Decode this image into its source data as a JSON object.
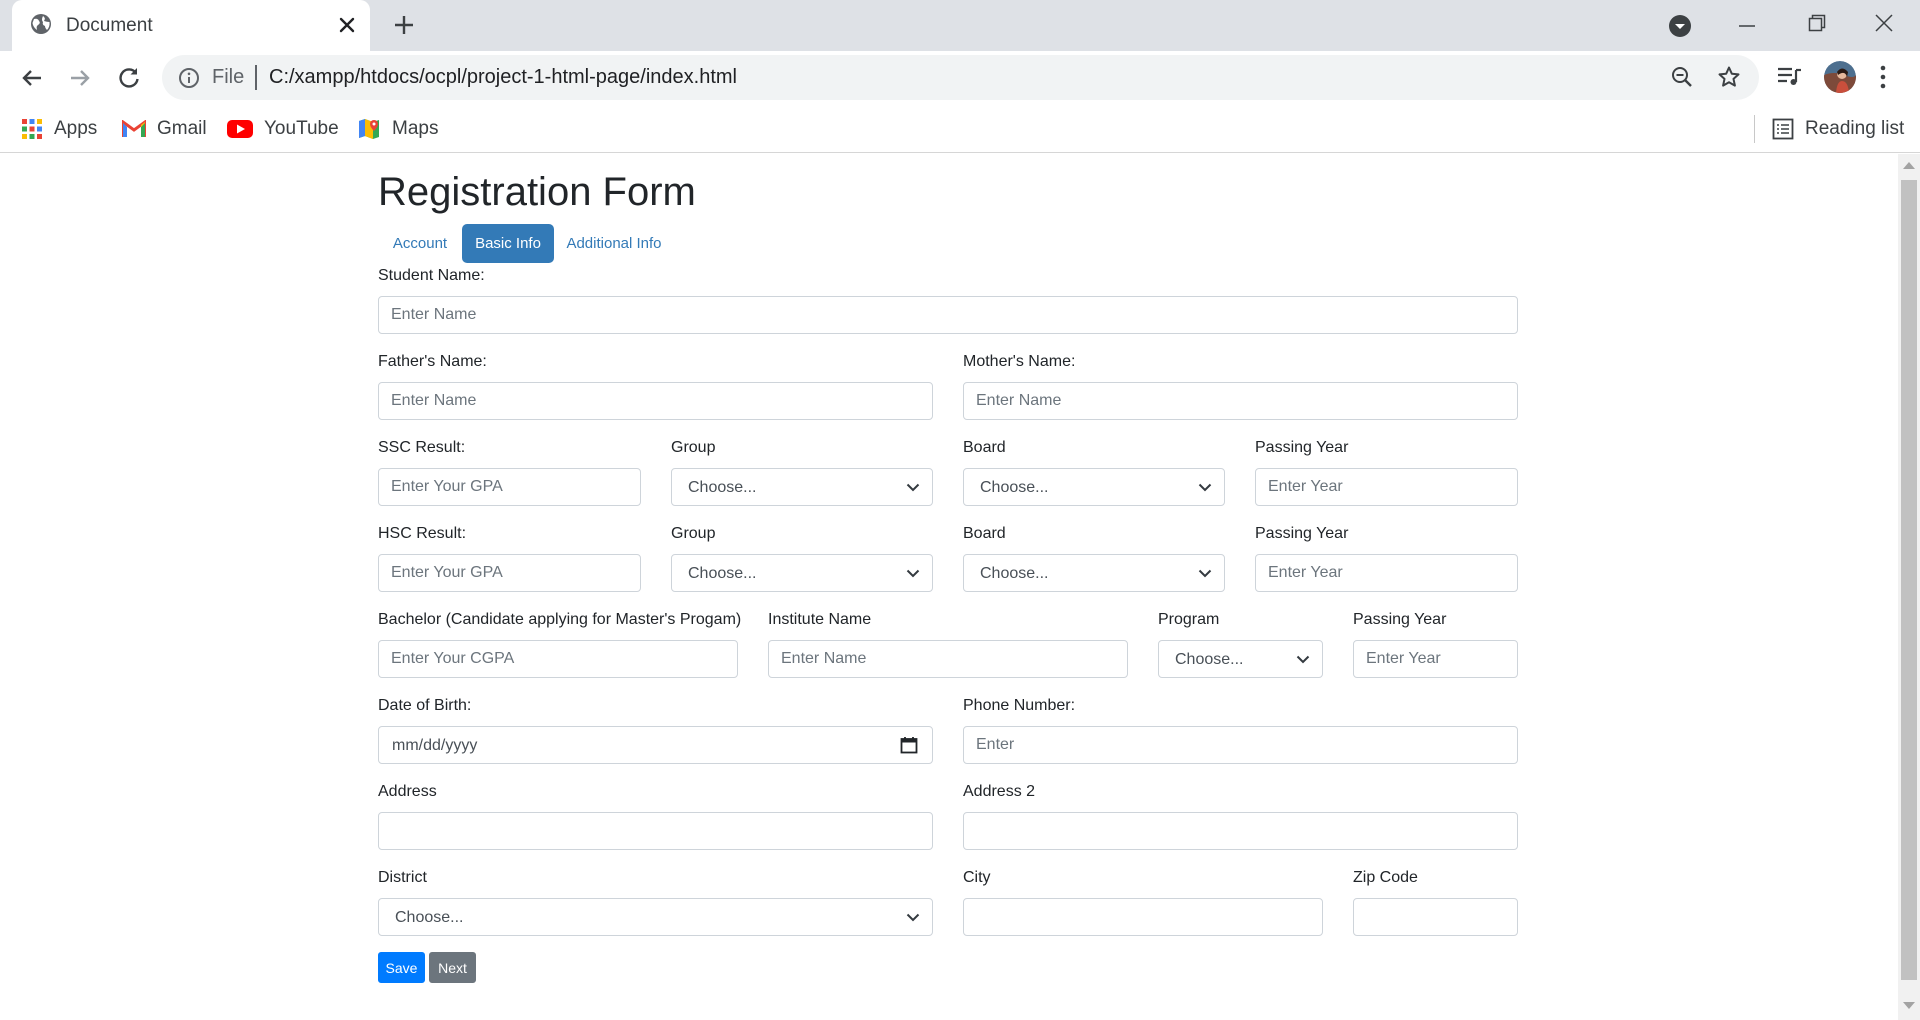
{
  "browser": {
    "tab_title": "Document",
    "url_scheme": "File",
    "url": "C:/xampp/htdocs/ocpl/project-1-html-page/index.html",
    "bookmarks": {
      "apps": "Apps",
      "gmail": "Gmail",
      "youtube": "YouTube",
      "maps": "Maps",
      "reading_list": "Reading list"
    }
  },
  "form": {
    "title": "Registration Form",
    "tabs": [
      {
        "label": "Account",
        "active": false
      },
      {
        "label": "Basic Info",
        "active": true
      },
      {
        "label": "Additional Info",
        "active": false
      }
    ],
    "student_name": {
      "label": "Student Name:",
      "placeholder": "Enter Name"
    },
    "father_name": {
      "label": "Father's Name:",
      "placeholder": "Enter Name"
    },
    "mother_name": {
      "label": "Mother's Name:",
      "placeholder": "Enter Name"
    },
    "ssc": {
      "result_label": "SSC Result:",
      "result_placeholder": "Enter Your GPA",
      "group_label": "Group",
      "group_value": "Choose...",
      "board_label": "Board",
      "board_value": "Choose...",
      "year_label": "Passing Year",
      "year_placeholder": "Enter Year"
    },
    "hsc": {
      "result_label": "HSC Result:",
      "result_placeholder": "Enter Your GPA",
      "group_label": "Group",
      "group_value": "Choose...",
      "board_label": "Board",
      "board_value": "Choose...",
      "year_label": "Passing Year",
      "year_placeholder": "Enter Year"
    },
    "bachelor": {
      "label": "Bachelor (Candidate applying for Master's Progam)",
      "placeholder": "Enter Your CGPA",
      "institute_label": "Institute Name",
      "institute_placeholder": "Enter Name",
      "program_label": "Program",
      "program_value": "Choose...",
      "year_label": "Passing Year",
      "year_placeholder": "Enter Year"
    },
    "dob": {
      "label": "Date of Birth:",
      "placeholder": "mm/dd/yyyy"
    },
    "phone": {
      "label": "Phone Number:",
      "placeholder": "Enter"
    },
    "address": {
      "label": "Address",
      "value": ""
    },
    "address2": {
      "label": "Address 2",
      "value": ""
    },
    "district": {
      "label": "District",
      "value": "Choose..."
    },
    "city": {
      "label": "City",
      "value": ""
    },
    "zip": {
      "label": "Zip Code",
      "value": ""
    },
    "save_label": "Save",
    "next_label": "Next"
  },
  "colors": {
    "primary": "#007bff",
    "tab_active": "#337ab7",
    "secondary": "#6c757d"
  }
}
